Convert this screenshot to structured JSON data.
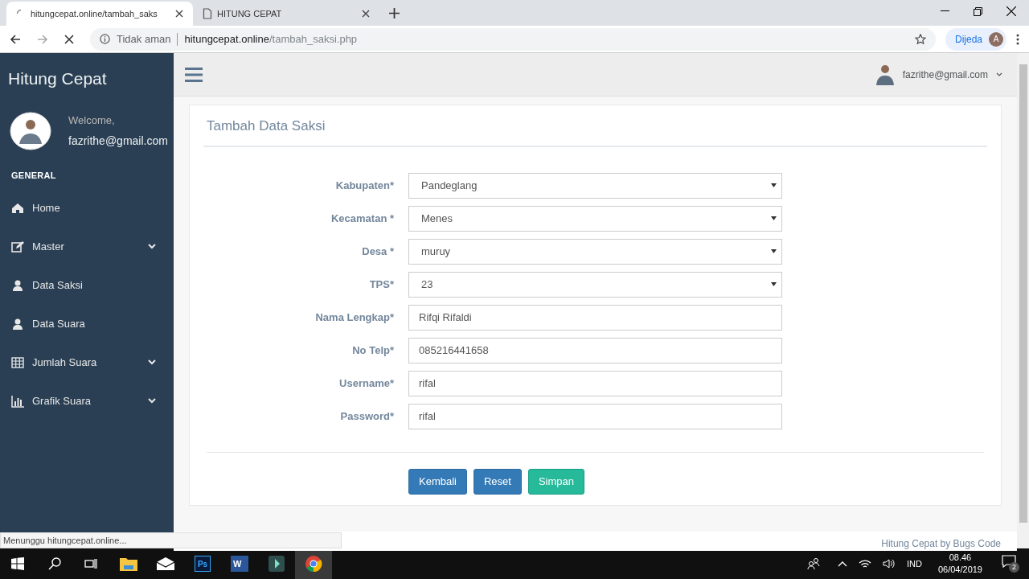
{
  "browser": {
    "tabs": [
      {
        "title": "hitungcepat.online/tambah_saks",
        "kind": "loading",
        "selected": true
      },
      {
        "title": "HITUNG CEPAT",
        "kind": "page",
        "selected": false
      }
    ],
    "address": {
      "security": "Tidak aman",
      "host": "hitungcepat.online",
      "path": "/tambah_saksi.php"
    },
    "profile": {
      "label": "Dijeda",
      "initial": "A"
    }
  },
  "sidebar": {
    "brand": "Hitung Cepat",
    "welcome": "Welcome,",
    "user": "fazrithe@gmail.com",
    "section": "GENERAL",
    "items": [
      {
        "label": "Home",
        "kind": "home",
        "expandable": false
      },
      {
        "label": "Master",
        "kind": "edit",
        "expandable": true
      },
      {
        "label": "Data Saksi",
        "kind": "user",
        "expandable": false
      },
      {
        "label": "Data Suara",
        "kind": "user",
        "expandable": false
      },
      {
        "label": "Jumlah Suara",
        "kind": "table",
        "expandable": true
      },
      {
        "label": "Grafik Suara",
        "kind": "chart",
        "expandable": true
      }
    ]
  },
  "topbar": {
    "user": "fazrithe@gmail.com"
  },
  "form": {
    "title": "Tambah Data Saksi",
    "fields": [
      {
        "label": "Kabupaten*",
        "kind": "select",
        "value": "Pandeglang"
      },
      {
        "label": "Kecamatan *",
        "kind": "select",
        "value": "Menes"
      },
      {
        "label": "Desa *",
        "kind": "select",
        "value": "muruy"
      },
      {
        "label": "TPS*",
        "kind": "select",
        "value": "23"
      },
      {
        "label": "Nama Lengkap*",
        "kind": "text",
        "value": "Rifqi Rifaldi"
      },
      {
        "label": "No Telp*",
        "kind": "text",
        "value": "085216441658"
      },
      {
        "label": "Username*",
        "kind": "text",
        "value": "rifal"
      },
      {
        "label": "Password*",
        "kind": "text",
        "value": "rifal"
      }
    ],
    "buttons": [
      {
        "label": "Kembali",
        "kind": "primary"
      },
      {
        "label": "Reset",
        "kind": "info"
      },
      {
        "label": "Simpan",
        "kind": "success"
      }
    ]
  },
  "footer": "Hitung Cepat by Bugs Code",
  "status_text": "Menunggu hitungcepat.online...",
  "taskbar": {
    "apps": [
      {
        "kind": "explorer"
      },
      {
        "kind": "mail"
      },
      {
        "kind": "ps",
        "label": "Ps"
      },
      {
        "kind": "word",
        "label": "W"
      },
      {
        "kind": "editor"
      },
      {
        "kind": "chrome"
      }
    ],
    "language": "IND",
    "time": "08.46",
    "date": "06/04/2019",
    "notifications": "2"
  }
}
